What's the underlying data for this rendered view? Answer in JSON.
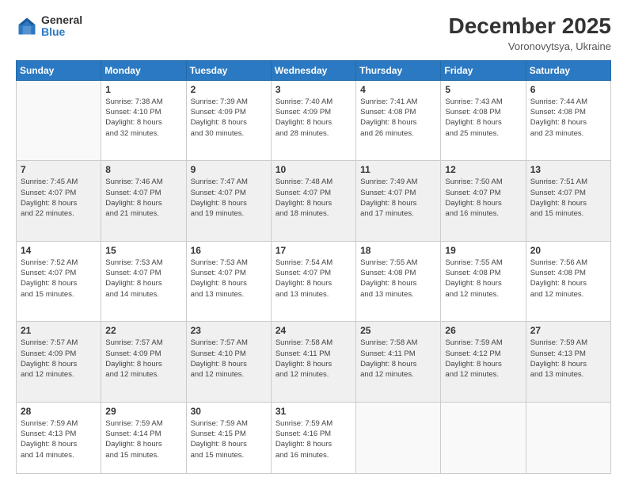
{
  "header": {
    "logo_general": "General",
    "logo_blue": "Blue",
    "month_title": "December 2025",
    "location": "Voronovytsya, Ukraine"
  },
  "weekdays": [
    "Sunday",
    "Monday",
    "Tuesday",
    "Wednesday",
    "Thursday",
    "Friday",
    "Saturday"
  ],
  "weeks": [
    [
      {
        "day": null,
        "info": null
      },
      {
        "day": "1",
        "info": "Sunrise: 7:38 AM\nSunset: 4:10 PM\nDaylight: 8 hours\nand 32 minutes."
      },
      {
        "day": "2",
        "info": "Sunrise: 7:39 AM\nSunset: 4:09 PM\nDaylight: 8 hours\nand 30 minutes."
      },
      {
        "day": "3",
        "info": "Sunrise: 7:40 AM\nSunset: 4:09 PM\nDaylight: 8 hours\nand 28 minutes."
      },
      {
        "day": "4",
        "info": "Sunrise: 7:41 AM\nSunset: 4:08 PM\nDaylight: 8 hours\nand 26 minutes."
      },
      {
        "day": "5",
        "info": "Sunrise: 7:43 AM\nSunset: 4:08 PM\nDaylight: 8 hours\nand 25 minutes."
      },
      {
        "day": "6",
        "info": "Sunrise: 7:44 AM\nSunset: 4:08 PM\nDaylight: 8 hours\nand 23 minutes."
      }
    ],
    [
      {
        "day": "7",
        "info": "Sunrise: 7:45 AM\nSunset: 4:07 PM\nDaylight: 8 hours\nand 22 minutes."
      },
      {
        "day": "8",
        "info": "Sunrise: 7:46 AM\nSunset: 4:07 PM\nDaylight: 8 hours\nand 21 minutes."
      },
      {
        "day": "9",
        "info": "Sunrise: 7:47 AM\nSunset: 4:07 PM\nDaylight: 8 hours\nand 19 minutes."
      },
      {
        "day": "10",
        "info": "Sunrise: 7:48 AM\nSunset: 4:07 PM\nDaylight: 8 hours\nand 18 minutes."
      },
      {
        "day": "11",
        "info": "Sunrise: 7:49 AM\nSunset: 4:07 PM\nDaylight: 8 hours\nand 17 minutes."
      },
      {
        "day": "12",
        "info": "Sunrise: 7:50 AM\nSunset: 4:07 PM\nDaylight: 8 hours\nand 16 minutes."
      },
      {
        "day": "13",
        "info": "Sunrise: 7:51 AM\nSunset: 4:07 PM\nDaylight: 8 hours\nand 15 minutes."
      }
    ],
    [
      {
        "day": "14",
        "info": "Sunrise: 7:52 AM\nSunset: 4:07 PM\nDaylight: 8 hours\nand 15 minutes."
      },
      {
        "day": "15",
        "info": "Sunrise: 7:53 AM\nSunset: 4:07 PM\nDaylight: 8 hours\nand 14 minutes."
      },
      {
        "day": "16",
        "info": "Sunrise: 7:53 AM\nSunset: 4:07 PM\nDaylight: 8 hours\nand 13 minutes."
      },
      {
        "day": "17",
        "info": "Sunrise: 7:54 AM\nSunset: 4:07 PM\nDaylight: 8 hours\nand 13 minutes."
      },
      {
        "day": "18",
        "info": "Sunrise: 7:55 AM\nSunset: 4:08 PM\nDaylight: 8 hours\nand 13 minutes."
      },
      {
        "day": "19",
        "info": "Sunrise: 7:55 AM\nSunset: 4:08 PM\nDaylight: 8 hours\nand 12 minutes."
      },
      {
        "day": "20",
        "info": "Sunrise: 7:56 AM\nSunset: 4:08 PM\nDaylight: 8 hours\nand 12 minutes."
      }
    ],
    [
      {
        "day": "21",
        "info": "Sunrise: 7:57 AM\nSunset: 4:09 PM\nDaylight: 8 hours\nand 12 minutes."
      },
      {
        "day": "22",
        "info": "Sunrise: 7:57 AM\nSunset: 4:09 PM\nDaylight: 8 hours\nand 12 minutes."
      },
      {
        "day": "23",
        "info": "Sunrise: 7:57 AM\nSunset: 4:10 PM\nDaylight: 8 hours\nand 12 minutes."
      },
      {
        "day": "24",
        "info": "Sunrise: 7:58 AM\nSunset: 4:11 PM\nDaylight: 8 hours\nand 12 minutes."
      },
      {
        "day": "25",
        "info": "Sunrise: 7:58 AM\nSunset: 4:11 PM\nDaylight: 8 hours\nand 12 minutes."
      },
      {
        "day": "26",
        "info": "Sunrise: 7:59 AM\nSunset: 4:12 PM\nDaylight: 8 hours\nand 12 minutes."
      },
      {
        "day": "27",
        "info": "Sunrise: 7:59 AM\nSunset: 4:13 PM\nDaylight: 8 hours\nand 13 minutes."
      }
    ],
    [
      {
        "day": "28",
        "info": "Sunrise: 7:59 AM\nSunset: 4:13 PM\nDaylight: 8 hours\nand 14 minutes."
      },
      {
        "day": "29",
        "info": "Sunrise: 7:59 AM\nSunset: 4:14 PM\nDaylight: 8 hours\nand 15 minutes."
      },
      {
        "day": "30",
        "info": "Sunrise: 7:59 AM\nSunset: 4:15 PM\nDaylight: 8 hours\nand 15 minutes."
      },
      {
        "day": "31",
        "info": "Sunrise: 7:59 AM\nSunset: 4:16 PM\nDaylight: 8 hours\nand 16 minutes."
      },
      {
        "day": null,
        "info": null
      },
      {
        "day": null,
        "info": null
      },
      {
        "day": null,
        "info": null
      }
    ]
  ]
}
